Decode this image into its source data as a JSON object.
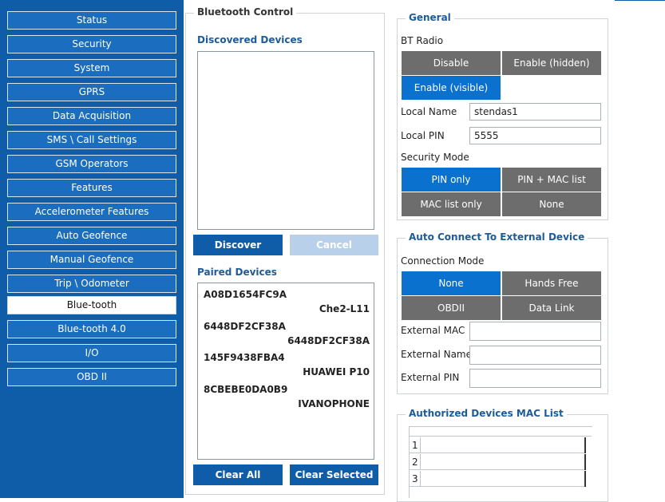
{
  "sidebar": {
    "items": [
      {
        "label": "Status",
        "active": false
      },
      {
        "label": "Security",
        "active": false
      },
      {
        "label": "System",
        "active": false
      },
      {
        "label": "GPRS",
        "active": false
      },
      {
        "label": "Data Acquisition",
        "active": false
      },
      {
        "label": "SMS \\ Call Settings",
        "active": false
      },
      {
        "label": "GSM Operators",
        "active": false
      },
      {
        "label": "Features",
        "active": false
      },
      {
        "label": "Accelerometer Features",
        "active": false
      },
      {
        "label": "Auto Geofence",
        "active": false
      },
      {
        "label": "Manual Geofence",
        "active": false
      },
      {
        "label": "Trip \\ Odometer",
        "active": false
      },
      {
        "label": "Blue-tooth",
        "active": true
      },
      {
        "label": "Blue-tooth 4.0",
        "active": false
      },
      {
        "label": "I/O",
        "active": false
      },
      {
        "label": "OBD II",
        "active": false
      }
    ]
  },
  "bluetooth_control": {
    "title": "Bluetooth Control",
    "discovered_label": "Discovered Devices",
    "discover_button": "Discover",
    "cancel_button": "Cancel",
    "paired_label": "Paired Devices",
    "paired_devices": [
      {
        "mac": "A08D1654FC9A",
        "name": "Che2-L11"
      },
      {
        "mac": "6448DF2CF38A",
        "name": "6448DF2CF38A"
      },
      {
        "mac": "145F9438FBA4",
        "name": "HUAWEI P10"
      },
      {
        "mac": "8CBEBE0DA0B9",
        "name": "IVANOPHONE"
      }
    ],
    "clear_all_button": "Clear All",
    "clear_selected_button": "Clear Selected"
  },
  "general": {
    "title": "General",
    "bt_radio_label": "BT Radio",
    "bt_radio_options": [
      "Disable",
      "Enable (hidden)",
      "Enable (visible)"
    ],
    "bt_radio_selected": "Enable (visible)",
    "local_name_label": "Local Name",
    "local_name_value": "stendas1",
    "local_pin_label": "Local PIN",
    "local_pin_value": "5555",
    "security_mode_label": "Security Mode",
    "security_mode_options": [
      "PIN only",
      "PIN + MAC list",
      "MAC list only",
      "None"
    ],
    "security_mode_selected": "PIN only"
  },
  "auto_connect": {
    "title": "Auto Connect To External Device",
    "connection_mode_label": "Connection Mode",
    "connection_mode_options": [
      "None",
      "Hands Free",
      "OBDII",
      "Data Link"
    ],
    "connection_mode_selected": "None",
    "external_mac_label": "External MAC",
    "external_mac_value": "",
    "external_name_label": "External Name",
    "external_name_value": "",
    "external_pin_label": "External PIN",
    "external_pin_value": ""
  },
  "authorized_list": {
    "title": "Authorized Devices MAC List",
    "rows": [
      "1",
      "2",
      "3"
    ]
  },
  "colors": {
    "sidebar_bg": "#0f5ca8",
    "accent_blue": "#0b71cf",
    "option_gray": "#6d6d6d",
    "legend_blue": "#1d5b99"
  }
}
